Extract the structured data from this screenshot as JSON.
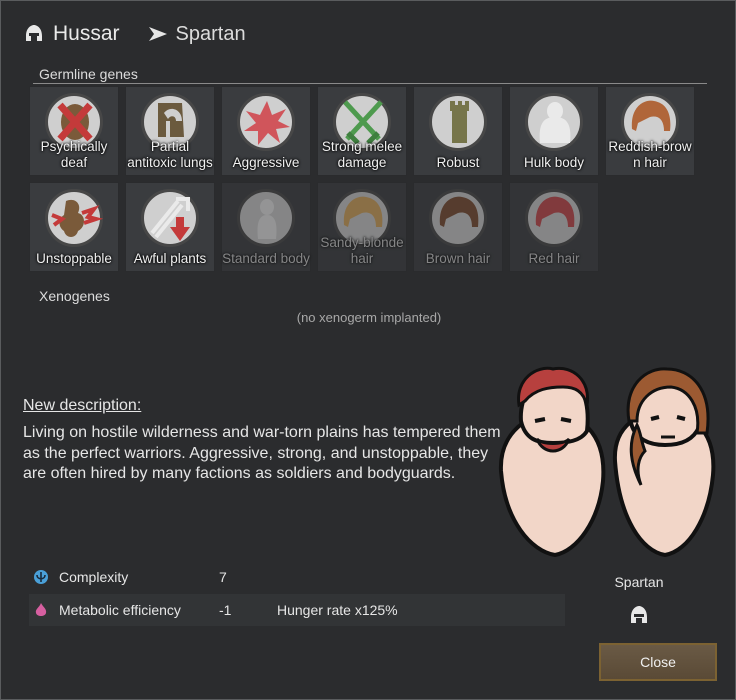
{
  "header": {
    "title": "Hussar",
    "subtitle": "Spartan"
  },
  "germline": {
    "label": "Germline genes",
    "genes": [
      {
        "label": "Psychically deaf",
        "icon": "psychically-deaf-icon",
        "active": true
      },
      {
        "label": "Partial antitoxic lungs",
        "icon": "antitoxic-lungs-icon",
        "active": true
      },
      {
        "label": "Aggressive",
        "icon": "aggressive-icon",
        "active": true
      },
      {
        "label": "Strong melee damage",
        "icon": "melee-damage-icon",
        "active": true
      },
      {
        "label": "Robust",
        "icon": "robust-icon",
        "active": true
      },
      {
        "label": "Hulk body",
        "icon": "hulk-body-icon",
        "active": true
      },
      {
        "label": "Reddish-brow n hair",
        "icon": "reddish-brown-hair-icon",
        "active": true
      },
      {
        "label": "Unstoppable",
        "icon": "unstoppable-icon",
        "active": true
      },
      {
        "label": "Awful plants",
        "icon": "awful-plants-icon",
        "active": true
      },
      {
        "label": "Standard body",
        "icon": "standard-body-icon",
        "active": false
      },
      {
        "label": "Sandy-blonde hair",
        "icon": "sandy-blonde-hair-icon",
        "active": false
      },
      {
        "label": "Brown hair",
        "icon": "brown-hair-icon",
        "active": false
      },
      {
        "label": "Red hair",
        "icon": "red-hair-icon",
        "active": false
      }
    ]
  },
  "xenogenes": {
    "label": "Xenogenes",
    "empty_text": "(no xenogerm implanted)"
  },
  "description": {
    "title": "New description:",
    "body": "Living on hostile wilderness and war-torn plains has tempered them as the perfect warriors. Aggressive, strong, and unstoppable, they are often hired by many factions as soldiers and bodyguards."
  },
  "stats": [
    {
      "name": "Complexity",
      "value": "7",
      "note": "",
      "icon": "complexity-icon",
      "icon_color": "#4aa0d8"
    },
    {
      "name": "Metabolic efficiency",
      "value": "-1",
      "note": "Hunger rate x125%",
      "icon": "metabolism-icon",
      "icon_color": "#d65fa0"
    }
  ],
  "xenotype": {
    "label": "Spartan",
    "icon": "helmet-icon"
  },
  "buttons": {
    "close": "Close"
  },
  "colors": {
    "window_bg": "#2b2c2e",
    "gene_tile": "#3a3c3f",
    "button_border": "#7c6232"
  }
}
